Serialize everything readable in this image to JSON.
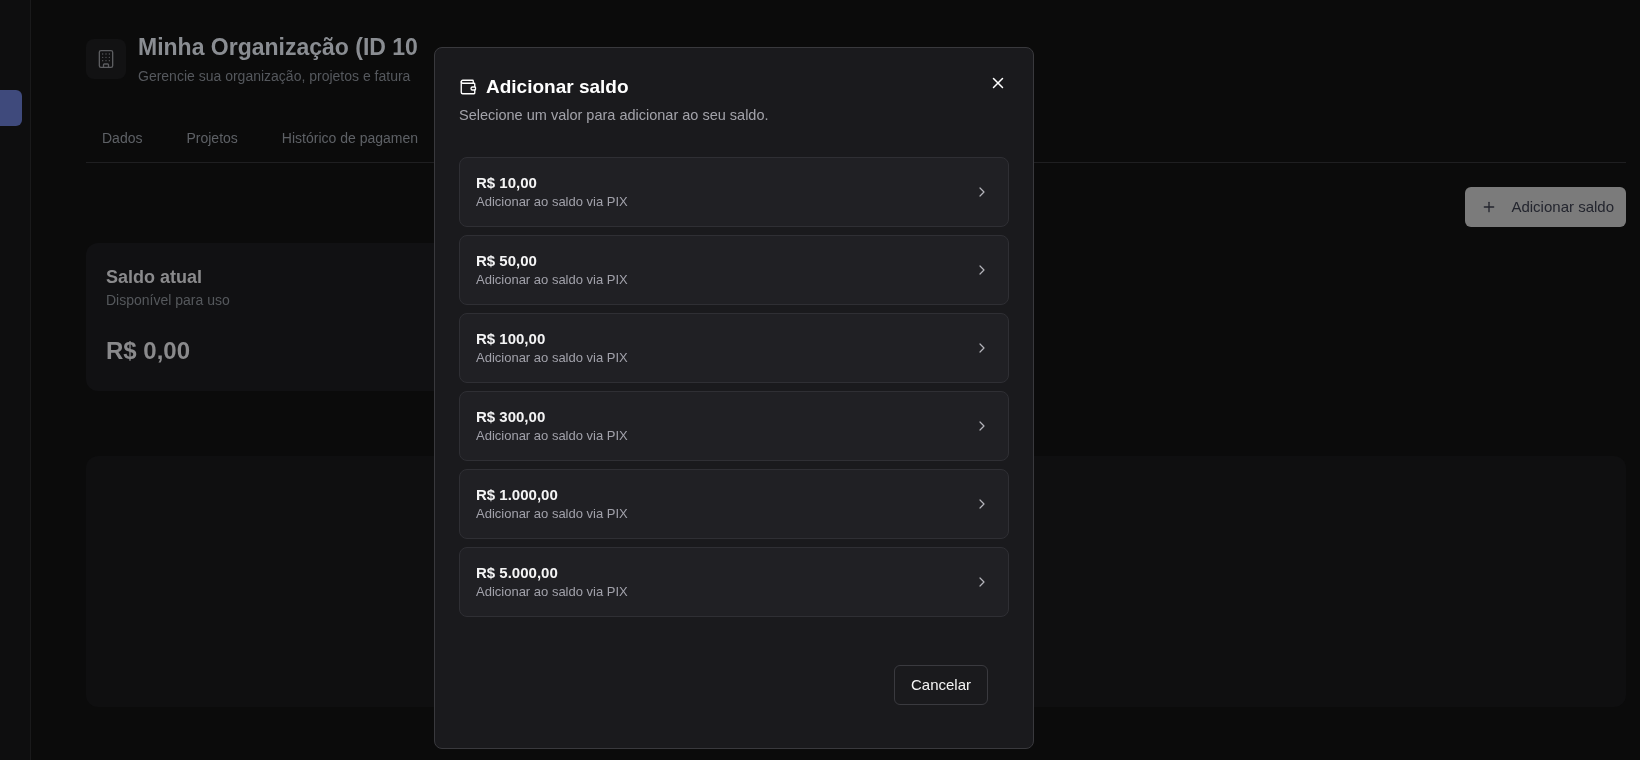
{
  "sidebar": {
    "items": [
      {
        "selected": true
      }
    ]
  },
  "page": {
    "header": {
      "title": "Minha Organização (ID 10",
      "subtitle": "Gerencie sua organização, projetos e fatura"
    },
    "tabs": [
      {
        "label": "Dados",
        "selected": false
      },
      {
        "label": "Projetos",
        "selected": false
      },
      {
        "label": "Histórico de pagamen",
        "selected": false
      }
    ],
    "add_button": {
      "label": "Adicionar saldo"
    },
    "balance_card": {
      "title": "Saldo atual",
      "subtitle": "Disponível para uso",
      "amount": "R$ 0,00"
    }
  },
  "dialog": {
    "title": "Adicionar saldo",
    "description": "Selecione um valor para adicionar ao seu saldo.",
    "options": [
      {
        "amount": "R$ 10,00",
        "description": "Adicionar ao saldo via PIX"
      },
      {
        "amount": "R$ 50,00",
        "description": "Adicionar ao saldo via PIX"
      },
      {
        "amount": "R$ 100,00",
        "description": "Adicionar ao saldo via PIX"
      },
      {
        "amount": "R$ 300,00",
        "description": "Adicionar ao saldo via PIX"
      },
      {
        "amount": "R$ 1.000,00",
        "description": "Adicionar ao saldo via PIX"
      },
      {
        "amount": "R$ 5.000,00",
        "description": "Adicionar ao saldo via PIX"
      }
    ],
    "cancel_button": {
      "label": "Cancelar"
    }
  }
}
